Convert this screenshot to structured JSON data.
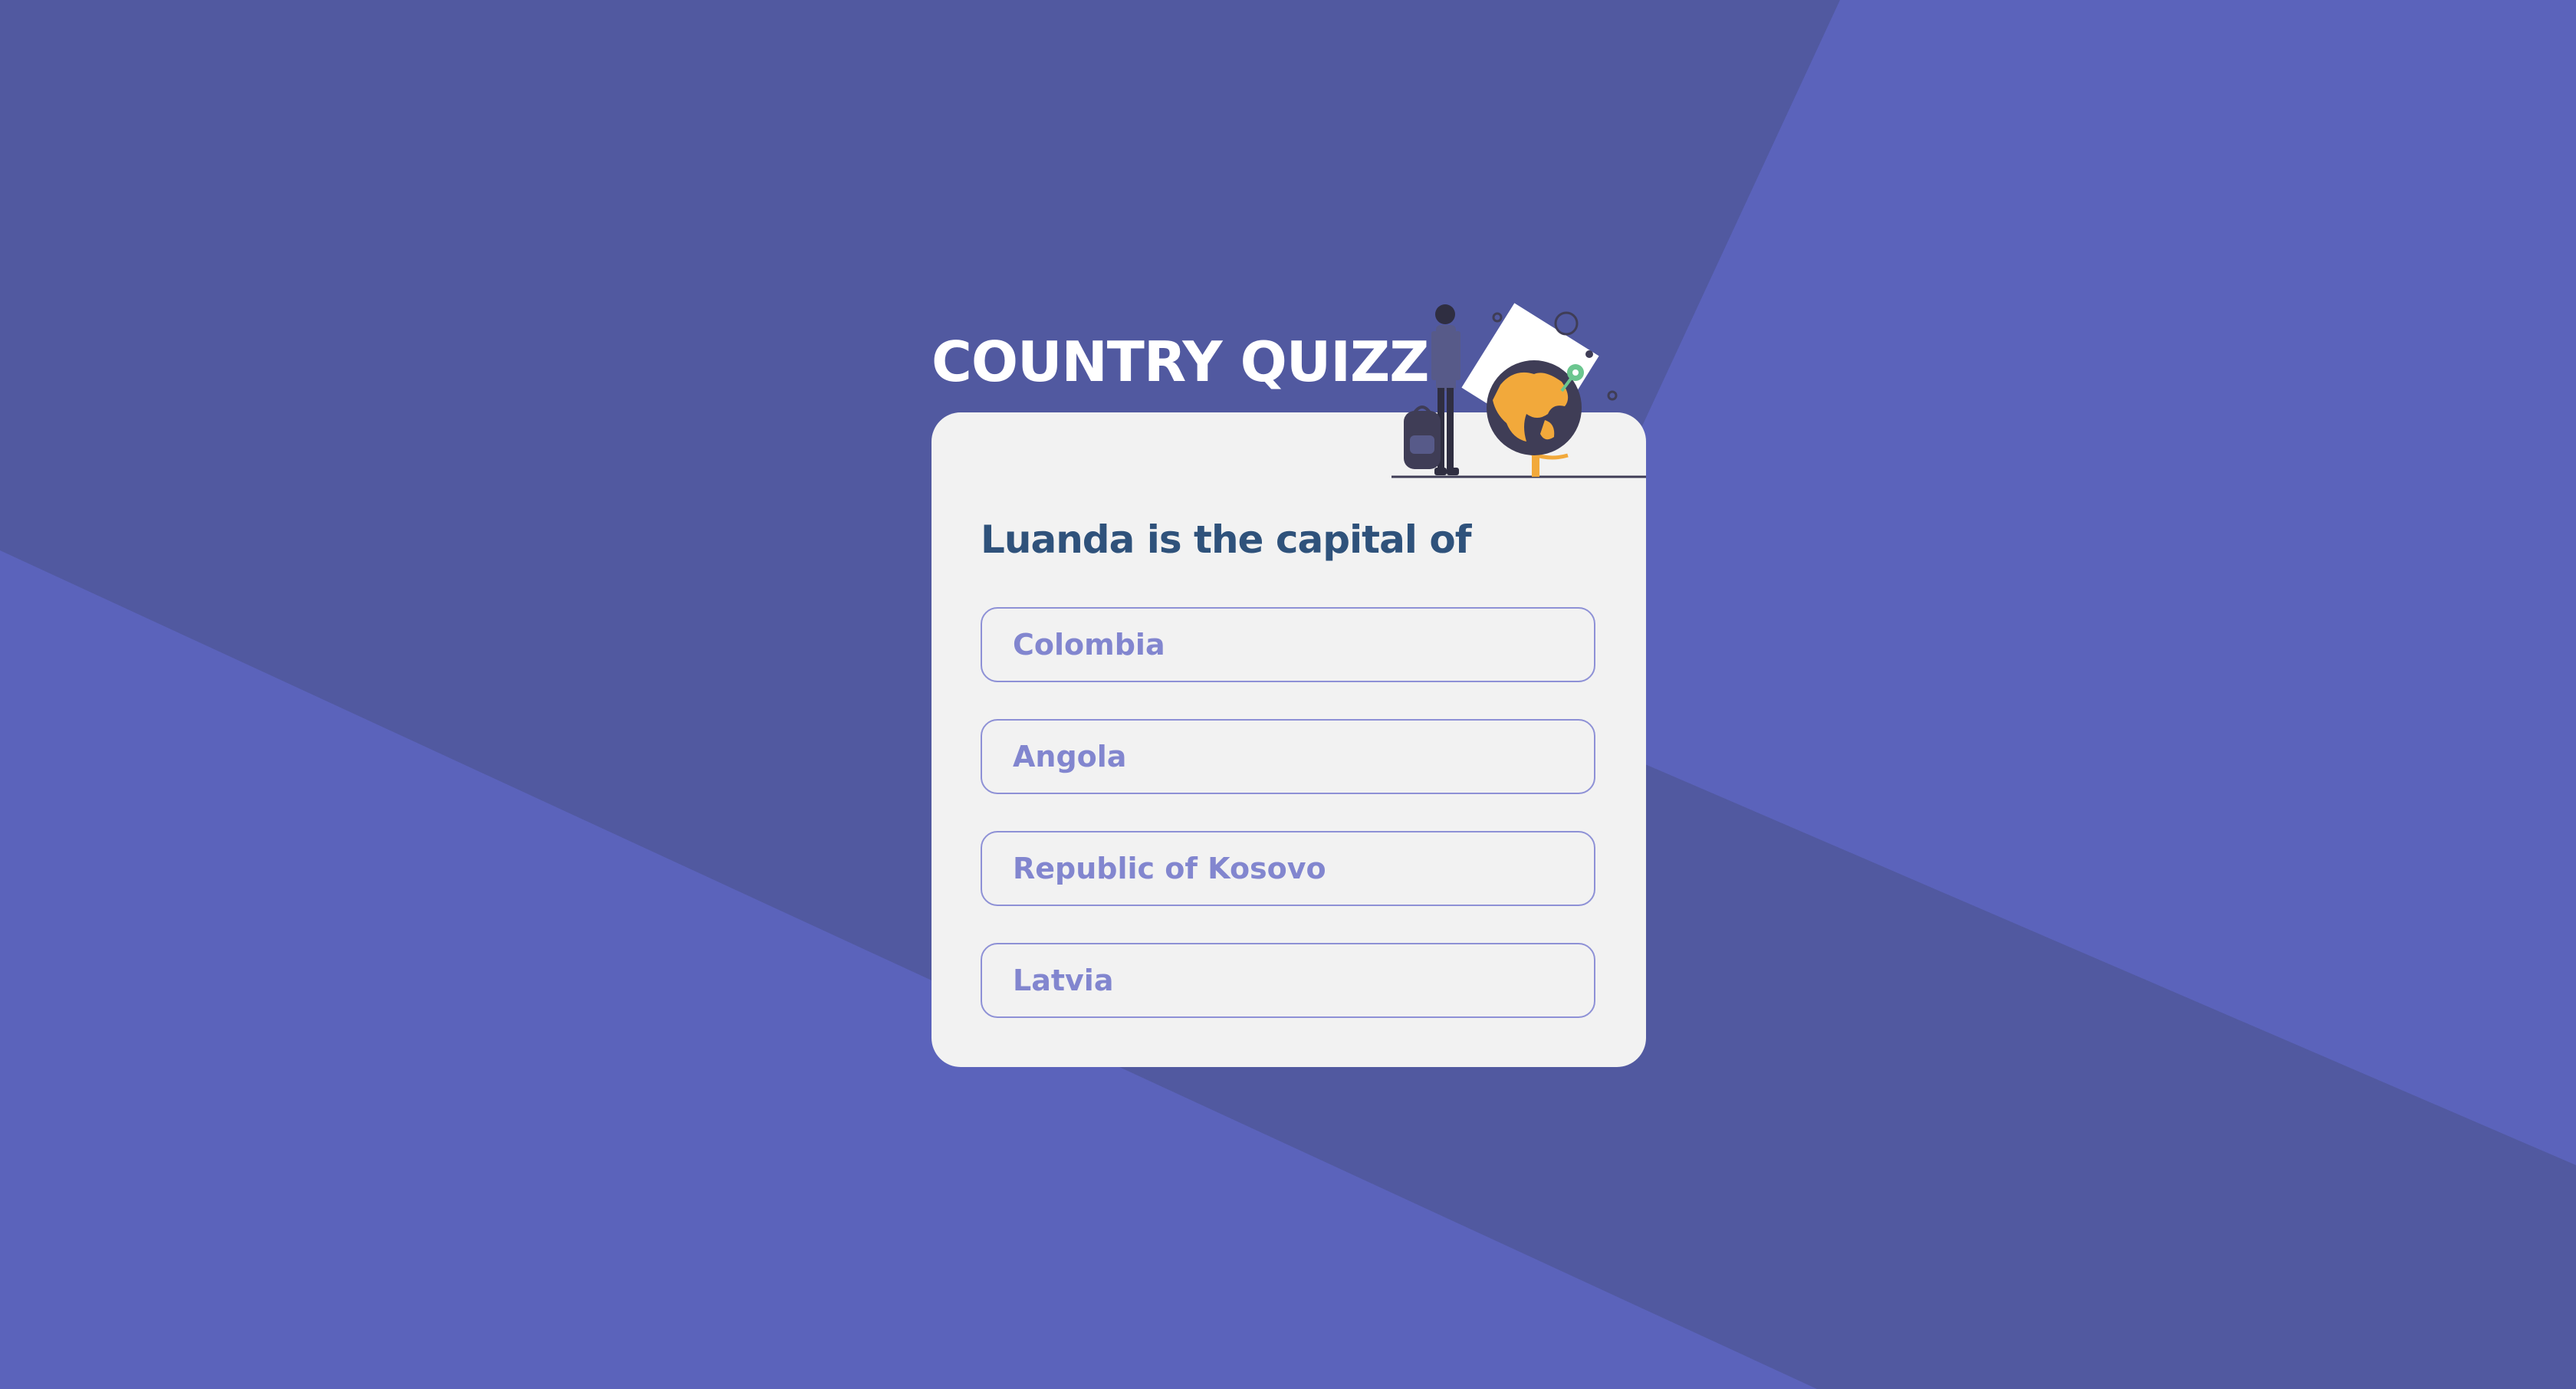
{
  "app": {
    "title": "COUNTRY QUIZZ"
  },
  "illustration": {
    "icon": "traveler-with-globe-illustration"
  },
  "question": {
    "text": "Luanda is the capital of"
  },
  "options": [
    {
      "label": "Colombia"
    },
    {
      "label": "Angola"
    },
    {
      "label": "Republic of Kosovo"
    },
    {
      "label": "Latvia"
    }
  ],
  "colors": {
    "background_light": "#5b63bb",
    "background_dark": "#5159a0",
    "card": "#f2f2f2",
    "question_text": "#2f527b",
    "option_text": "#8286cf",
    "option_border": "#8e91d6",
    "globe_accent": "#f2a93b"
  }
}
